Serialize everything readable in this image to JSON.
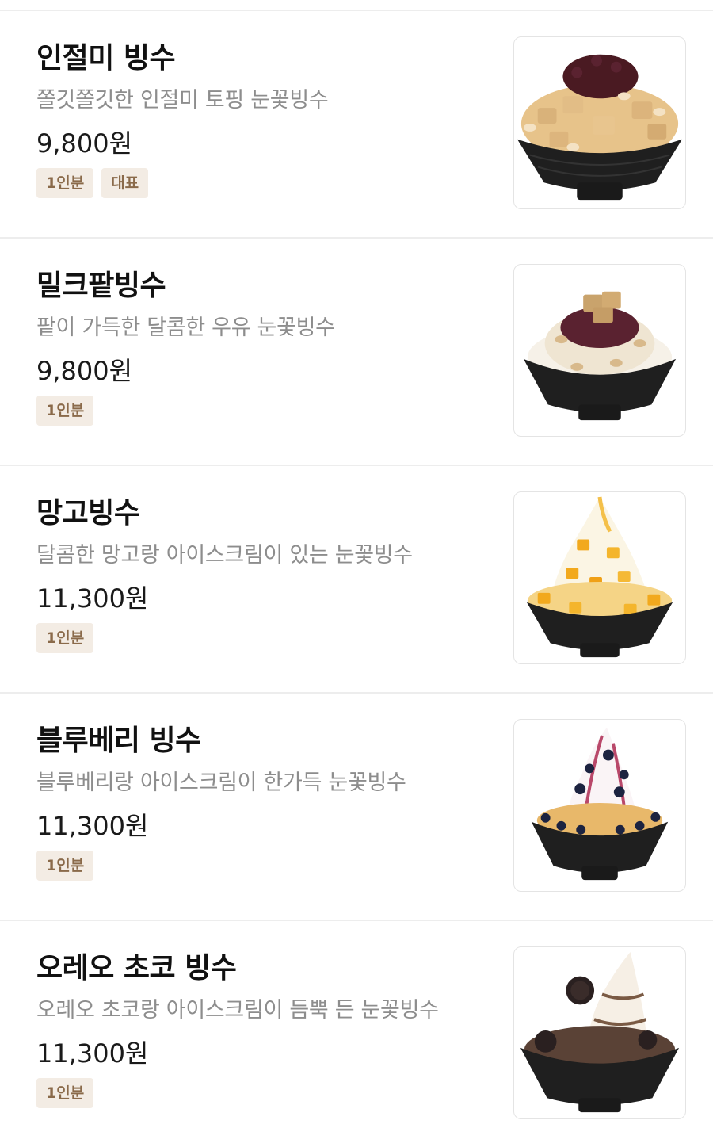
{
  "menu": {
    "items": [
      {
        "name": "인절미 빙수",
        "description": "쫄깃쫄깃한 인절미 토핑 눈꽃빙수",
        "price": "9,800원",
        "badges": [
          "1인분",
          "대표"
        ],
        "image_icon": "injeolmi-bingsu-image"
      },
      {
        "name": "밀크팥빙수",
        "description": "팥이 가득한 달콤한 우유 눈꽃빙수",
        "price": "9,800원",
        "badges": [
          "1인분"
        ],
        "image_icon": "milk-patbingsu-image"
      },
      {
        "name": "망고빙수",
        "description": "달콤한 망고랑 아이스크림이 있는 눈꽃빙수",
        "price": "11,300원",
        "badges": [
          "1인분"
        ],
        "image_icon": "mango-bingsu-image"
      },
      {
        "name": "블루베리 빙수",
        "description": "블루베리랑 아이스크림이 한가득  눈꽃빙수",
        "price": "11,300원",
        "badges": [
          "1인분"
        ],
        "image_icon": "blueberry-bingsu-image"
      },
      {
        "name": "오레오 초코 빙수",
        "description": "오레오 초코랑 아이스크림이 듬뿍 든 눈꽃빙수",
        "price": "11,300원",
        "badges": [
          "1인분"
        ],
        "image_icon": "oreo-choco-bingsu-image"
      }
    ]
  },
  "colors": {
    "badge_bg": "#f3ece4",
    "badge_text": "#8a6a4a",
    "description_text": "#8d8d8d",
    "bowl": "#1f1f1f"
  }
}
